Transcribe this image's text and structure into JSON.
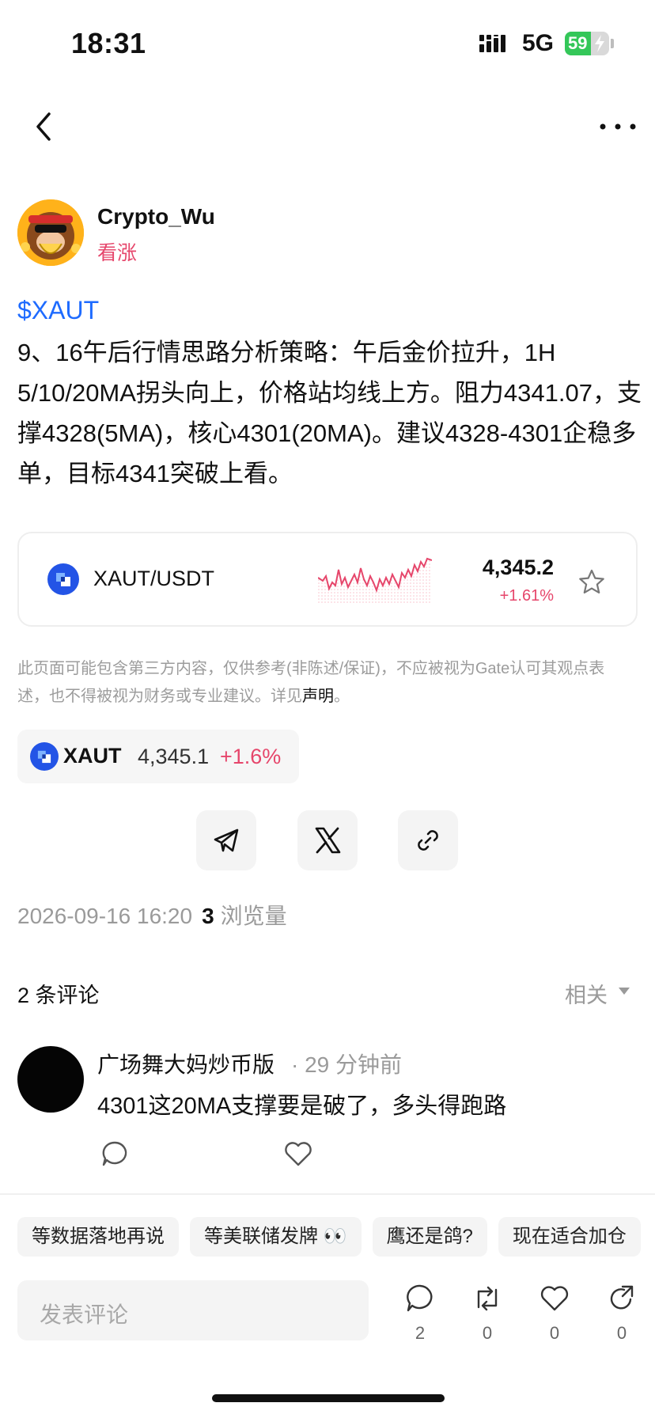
{
  "status_bar": {
    "time": "18:31",
    "network": "5G",
    "battery_percent": 59,
    "battery_label": "59",
    "battery_color": "#34c759",
    "signal_icon": "signal-bars-icon",
    "battery_charging_icon": "bolt-icon"
  },
  "nav": {
    "back_icon": "chevron-left-icon",
    "more_icon": "ellipsis-icon"
  },
  "author": {
    "name": "Crypto_Wu",
    "sentiment": "看涨",
    "sentiment_color": "#e6466b"
  },
  "post": {
    "ticker": "$XAUT",
    "ticker_color": "#1e6bff",
    "body": "9、16午后行情思路分析策略：午后金价拉升，1H 5/10/20MA拐头向上，价格站均线上方。阻力4341.07，支撑4328(5MA)，核心4301(20MA)。建议4328-4301企稳多单，目标4341突破上看。"
  },
  "ticker_card": {
    "pair": "XAUT/USDT",
    "price": "4,345.2",
    "change": "+1.61%",
    "change_color": "#e6466b",
    "favorite_icon": "star-icon"
  },
  "disclaimer": {
    "text": "此页面可能包含第三方内容，仅供参考(非陈述/保证)，不应被视为Gate认可其观点表述，也不得被视为财务或专业建议。详见",
    "link": "声明",
    "end": "。"
  },
  "asset_chip": {
    "symbol": "XAUT",
    "price": "4,345.1",
    "change": "+1.6%"
  },
  "share": {
    "items": [
      "telegram-icon",
      "x-icon",
      "link-icon"
    ]
  },
  "meta": {
    "datetime": "2026-09-16 16:20",
    "views": "3",
    "views_label": "浏览量"
  },
  "comments": {
    "header": "2 条评论",
    "sort_label": "相关",
    "items": [
      {
        "user": "广场舞大妈炒币版",
        "time": "· 29 分钟前",
        "text": "4301这20MA支撑要是破了，多头得跑路"
      }
    ]
  },
  "bottom_bar": {
    "quick_replies": [
      "等数据落地再说",
      "等美联储发牌 👀",
      "鹰还是鸽?",
      "现在适合加仓"
    ],
    "input_placeholder": "发表评论",
    "actions": [
      {
        "icon": "comment-icon",
        "count": "2"
      },
      {
        "icon": "repost-icon",
        "count": "0"
      },
      {
        "icon": "heart-icon",
        "count": "0"
      },
      {
        "icon": "share-icon",
        "count": "0"
      }
    ]
  }
}
